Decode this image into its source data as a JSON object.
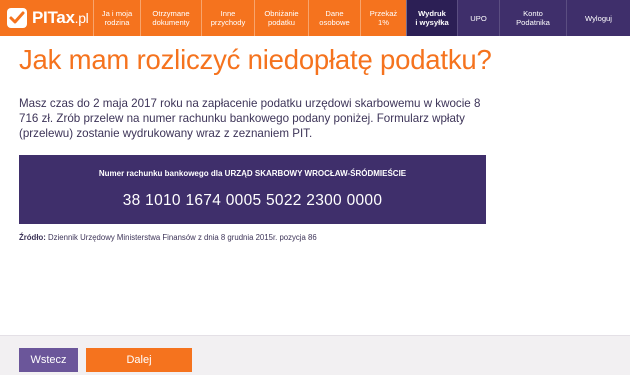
{
  "logo": {
    "text": "PITax",
    "suffix": ".pl",
    "icon": "pitax-logo-icon"
  },
  "nav": [
    {
      "label": "Ja i moja\nrodzina",
      "style": "orange"
    },
    {
      "label": "Otrzymane\ndokumenty",
      "style": "orange"
    },
    {
      "label": "Inne\nprzychody",
      "style": "orange"
    },
    {
      "label": "Obniżanie\npodatku",
      "style": "orange"
    },
    {
      "label": "Dane\nosobowe",
      "style": "orange"
    },
    {
      "label": "Przekaż\n1%",
      "style": "orange"
    },
    {
      "label": "Wydruk\ni wysyłka",
      "style": "active"
    },
    {
      "label": "UPO",
      "style": "dark"
    },
    {
      "label": "Konto\nPodatnika",
      "style": "dark"
    },
    {
      "label": "Wyloguj",
      "style": "dark"
    }
  ],
  "page": {
    "title": "Jak mam rozliczyć niedopłatę podatku?",
    "info": "Masz czas do 2 maja 2017 roku na zapłacenie podatku urzędowi skarbowemu w kwocie 8 716 zł. Zrób przelew na numer rachunku bankowego podany poniżej.  Formularz wpłaty (przelewu) zostanie wydrukowany wraz z zeznaniem PIT."
  },
  "account": {
    "label": "Numer rachunku bankowego dla URZĄD SKARBOWY WROCŁAW-ŚRÓDMIEŚCIE",
    "number": "38 1010 1674 0005 5022 2300 0000"
  },
  "source": {
    "label": "Źródło:",
    "text": " Dziennik Urzędowy Ministerstwa Finansów z dnia 8 grudnia 2015r. pozycja 86"
  },
  "footer": {
    "back_label": "Wstecz",
    "next_label": "Dalej"
  },
  "colors": {
    "accent": "#f5731e",
    "brand_dark": "#3f2f6b",
    "back_button": "#6b569a"
  }
}
